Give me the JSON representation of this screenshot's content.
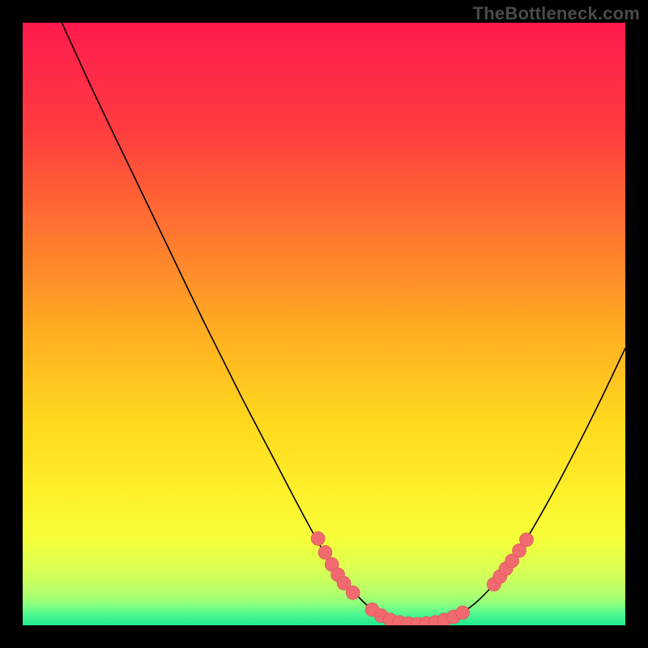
{
  "watermark": "TheBottleneck.com",
  "colors": {
    "frame_bg": "#000000",
    "curve": "#000000",
    "marker_fill": "#f06a6f",
    "marker_stroke": "#d95055",
    "gradient_stops": [
      {
        "offset": 0.0,
        "color": "#ff1a4e"
      },
      {
        "offset": 0.18,
        "color": "#ff3d3f"
      },
      {
        "offset": 0.36,
        "color": "#ff7a2f"
      },
      {
        "offset": 0.52,
        "color": "#ffb021"
      },
      {
        "offset": 0.66,
        "color": "#ffd81e"
      },
      {
        "offset": 0.78,
        "color": "#fff02a"
      },
      {
        "offset": 0.86,
        "color": "#f4ff3a"
      },
      {
        "offset": 0.91,
        "color": "#d8ff55"
      },
      {
        "offset": 0.945,
        "color": "#b6ff6a"
      },
      {
        "offset": 0.965,
        "color": "#8cff7e"
      },
      {
        "offset": 0.98,
        "color": "#54f98f"
      },
      {
        "offset": 1.0,
        "color": "#1de98e"
      }
    ]
  },
  "chart_data": {
    "type": "line",
    "title": "",
    "xlabel": "",
    "ylabel": "",
    "xlim": [
      0,
      100
    ],
    "ylim": [
      0,
      100
    ],
    "series": [
      {
        "name": "bottleneck-curve",
        "curve": [
          {
            "x": 6.5,
            "y": 100.0
          },
          {
            "x": 12.0,
            "y": 88.0
          },
          {
            "x": 18.0,
            "y": 75.5
          },
          {
            "x": 24.0,
            "y": 63.0
          },
          {
            "x": 30.0,
            "y": 50.5
          },
          {
            "x": 36.0,
            "y": 38.5
          },
          {
            "x": 42.0,
            "y": 27.0
          },
          {
            "x": 47.0,
            "y": 17.5
          },
          {
            "x": 51.0,
            "y": 10.5
          },
          {
            "x": 55.0,
            "y": 5.5
          },
          {
            "x": 58.0,
            "y": 2.6
          },
          {
            "x": 60.5,
            "y": 1.1
          },
          {
            "x": 63.0,
            "y": 0.4
          },
          {
            "x": 66.0,
            "y": 0.2
          },
          {
            "x": 69.0,
            "y": 0.5
          },
          {
            "x": 72.0,
            "y": 1.6
          },
          {
            "x": 75.0,
            "y": 3.6
          },
          {
            "x": 78.0,
            "y": 6.6
          },
          {
            "x": 81.0,
            "y": 10.4
          },
          {
            "x": 84.0,
            "y": 15.0
          },
          {
            "x": 88.0,
            "y": 22.0
          },
          {
            "x": 92.0,
            "y": 29.6
          },
          {
            "x": 96.0,
            "y": 37.6
          },
          {
            "x": 100.0,
            "y": 46.0
          }
        ]
      }
    ],
    "markers": {
      "left_cluster": [
        {
          "x": 49.0,
          "y": 14.4
        },
        {
          "x": 50.2,
          "y": 12.1
        },
        {
          "x": 51.3,
          "y": 10.1
        },
        {
          "x": 52.3,
          "y": 8.4
        },
        {
          "x": 53.3,
          "y": 7.0
        },
        {
          "x": 54.8,
          "y": 5.4
        }
      ],
      "valley_cluster": [
        {
          "x": 58.0,
          "y": 2.6
        },
        {
          "x": 59.5,
          "y": 1.6
        },
        {
          "x": 61.0,
          "y": 0.9
        },
        {
          "x": 62.5,
          "y": 0.5
        },
        {
          "x": 64.0,
          "y": 0.3
        },
        {
          "x": 65.5,
          "y": 0.2
        },
        {
          "x": 67.0,
          "y": 0.3
        },
        {
          "x": 68.5,
          "y": 0.5
        },
        {
          "x": 70.0,
          "y": 0.9
        },
        {
          "x": 71.5,
          "y": 1.4
        },
        {
          "x": 73.0,
          "y": 2.1
        }
      ],
      "right_cluster": [
        {
          "x": 78.2,
          "y": 6.8
        },
        {
          "x": 79.2,
          "y": 8.1
        },
        {
          "x": 80.2,
          "y": 9.4
        },
        {
          "x": 81.2,
          "y": 10.7
        },
        {
          "x": 82.4,
          "y": 12.4
        },
        {
          "x": 83.6,
          "y": 14.2
        }
      ]
    }
  }
}
